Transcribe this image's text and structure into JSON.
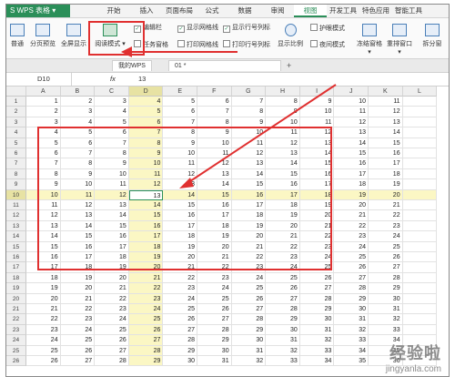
{
  "app": {
    "name": "S WPS 表格",
    "menu_arrow": "▾"
  },
  "ribbon_tabs": [
    "开始",
    "插入",
    "页面布局",
    "公式",
    "数据",
    "审阅",
    "视图",
    "开发工具",
    "特色应用",
    "智能工具箱"
  ],
  "active_tab": "视图",
  "ribbon": {
    "normal": "普通",
    "page_break": "分页预览",
    "fullscreen": "全屏显示",
    "reading_mode": "阅读模式 ▾",
    "edit_bar": "编辑栏",
    "show_gridlines": "显示网格线",
    "show_row_col_headers": "显示行号列标",
    "task_pane": "任务窗格",
    "print_gridlines": "打印网格线",
    "print_row_col_headers": "打印行号列标",
    "zoom": "显示比例",
    "eye_protect": "护眼模式",
    "night_mode": "夜间模式",
    "freeze_panes": "冻结窗格 ▾",
    "arrange_window": "重排窗口 ▾",
    "split_window": "拆分窗"
  },
  "doc_tabs": [
    "我的WPS",
    "01 *"
  ],
  "add_tab": "+",
  "name_box": "D10",
  "fx_label": "fx",
  "formula_value": "13",
  "columns": [
    "A",
    "B",
    "C",
    "D",
    "E",
    "F",
    "G",
    "H",
    "I",
    "J",
    "K",
    "L"
  ],
  "rows": [
    {
      "n": "1",
      "v": [
        1,
        2,
        3,
        4,
        5,
        6,
        7,
        8,
        9,
        10,
        11
      ]
    },
    {
      "n": "2",
      "v": [
        2,
        3,
        4,
        5,
        6,
        7,
        8,
        9,
        10,
        11,
        12
      ]
    },
    {
      "n": "3",
      "v": [
        3,
        4,
        5,
        6,
        7,
        8,
        9,
        10,
        11,
        12,
        13
      ]
    },
    {
      "n": "4",
      "v": [
        4,
        5,
        6,
        7,
        8,
        9,
        10,
        11,
        12,
        13,
        14
      ]
    },
    {
      "n": "5",
      "v": [
        5,
        6,
        7,
        8,
        9,
        10,
        11,
        12,
        13,
        14,
        15
      ]
    },
    {
      "n": "6",
      "v": [
        6,
        7,
        8,
        9,
        10,
        11,
        12,
        13,
        14,
        15,
        16
      ]
    },
    {
      "n": "7",
      "v": [
        7,
        8,
        9,
        10,
        11,
        12,
        13,
        14,
        15,
        16,
        17
      ]
    },
    {
      "n": "8",
      "v": [
        8,
        9,
        10,
        11,
        12,
        13,
        14,
        15,
        16,
        17,
        18
      ]
    },
    {
      "n": "9",
      "v": [
        9,
        10,
        11,
        12,
        13,
        14,
        15,
        16,
        17,
        18,
        19
      ]
    },
    {
      "n": "10",
      "v": [
        10,
        11,
        12,
        13,
        14,
        15,
        16,
        17,
        18,
        19,
        20
      ]
    },
    {
      "n": "11",
      "v": [
        11,
        12,
        13,
        14,
        15,
        16,
        17,
        18,
        19,
        20,
        21
      ]
    },
    {
      "n": "12",
      "v": [
        12,
        13,
        14,
        15,
        16,
        17,
        18,
        19,
        20,
        21,
        22
      ]
    },
    {
      "n": "13",
      "v": [
        13,
        14,
        15,
        16,
        17,
        18,
        19,
        20,
        21,
        22,
        23
      ]
    },
    {
      "n": "14",
      "v": [
        14,
        15,
        16,
        17,
        18,
        19,
        20,
        21,
        22,
        23,
        24
      ]
    },
    {
      "n": "15",
      "v": [
        15,
        16,
        17,
        18,
        19,
        20,
        21,
        22,
        23,
        24,
        25
      ]
    },
    {
      "n": "16",
      "v": [
        16,
        17,
        18,
        19,
        20,
        21,
        22,
        23,
        24,
        25,
        26
      ]
    },
    {
      "n": "17",
      "v": [
        17,
        18,
        19,
        20,
        21,
        22,
        23,
        24,
        25,
        26,
        27
      ]
    },
    {
      "n": "18",
      "v": [
        18,
        19,
        20,
        21,
        22,
        23,
        24,
        25,
        26,
        27,
        28
      ]
    },
    {
      "n": "19",
      "v": [
        19,
        20,
        21,
        22,
        23,
        24,
        25,
        26,
        27,
        28,
        29
      ]
    },
    {
      "n": "20",
      "v": [
        20,
        21,
        22,
        23,
        24,
        25,
        26,
        27,
        28,
        29,
        30
      ]
    },
    {
      "n": "21",
      "v": [
        21,
        22,
        23,
        24,
        25,
        26,
        27,
        28,
        29,
        30,
        31
      ]
    },
    {
      "n": "22",
      "v": [
        22,
        23,
        24,
        25,
        26,
        27,
        28,
        29,
        30,
        31,
        32
      ]
    },
    {
      "n": "23",
      "v": [
        23,
        24,
        25,
        26,
        27,
        28,
        29,
        30,
        31,
        32,
        33
      ]
    },
    {
      "n": "24",
      "v": [
        24,
        25,
        26,
        27,
        28,
        29,
        30,
        31,
        32,
        33,
        34
      ]
    },
    {
      "n": "25",
      "v": [
        25,
        26,
        27,
        28,
        29,
        30,
        31,
        32,
        33,
        34,
        35
      ]
    },
    {
      "n": "26",
      "v": [
        26,
        27,
        28,
        29,
        30,
        31,
        32,
        33,
        34,
        35,
        36
      ]
    }
  ],
  "active_cell": "D10",
  "watermark": {
    "text": "经验啦",
    "url": "jingyanla.com"
  },
  "colors": {
    "brand": "#2b8f59",
    "highlight": "#fbf7c4",
    "annotation": "#e03030"
  }
}
